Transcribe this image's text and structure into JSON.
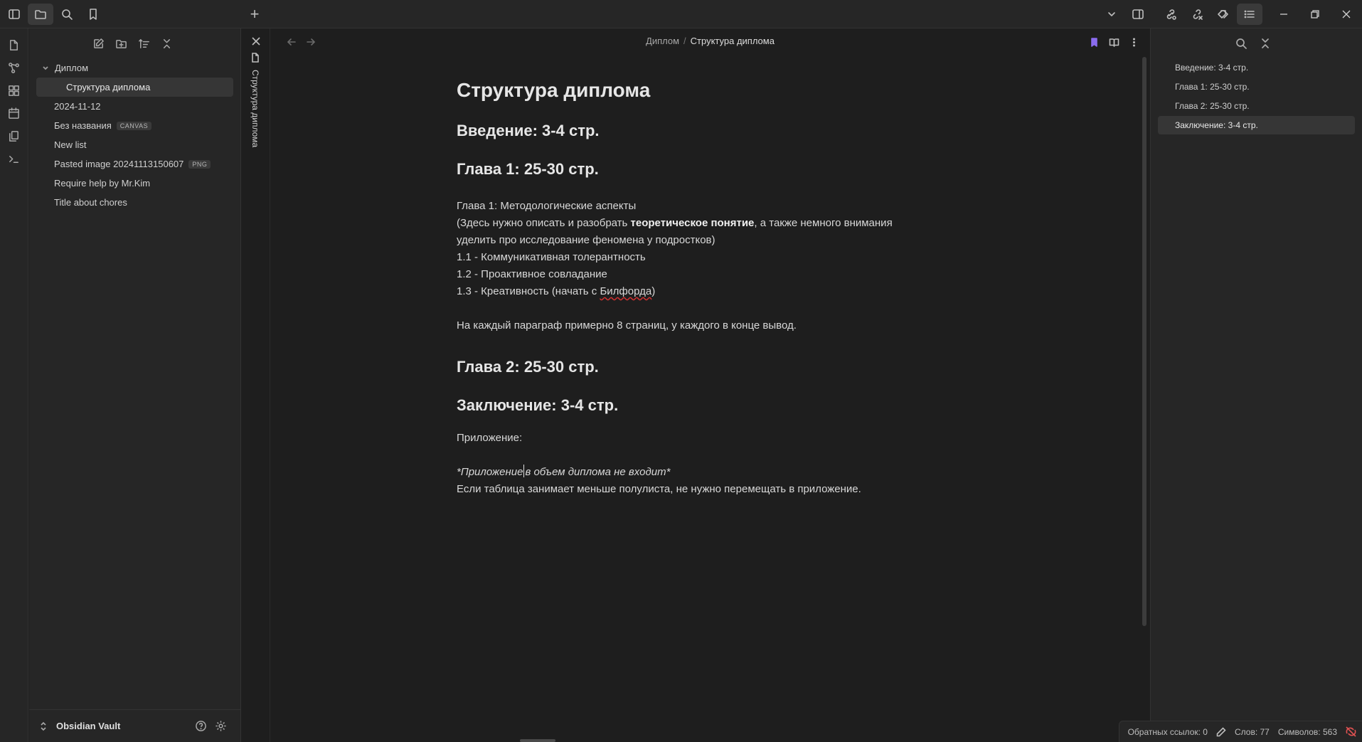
{
  "titlebar": {
    "new_tab_symbol": "+",
    "icons": [
      "sidebar-toggle-icon",
      "folder-icon",
      "search-icon",
      "bookmark-icon"
    ],
    "right_icons": [
      "chevron-down-icon",
      "split-pane-icon",
      "link-icon",
      "unlink-icon",
      "tags-icon",
      "outline-icon"
    ]
  },
  "ribbon": {
    "icons": [
      "files-icon",
      "graph-icon",
      "canvas-icon",
      "calendar-icon",
      "copy-icon",
      "terminal-icon"
    ]
  },
  "explorer": {
    "tools": [
      "new-note-icon",
      "new-folder-icon",
      "sort-icon",
      "collapse-icon"
    ],
    "folder": "Диплом",
    "child": "Структура диплома",
    "files": [
      {
        "name": "2024-11-12",
        "badge": ""
      },
      {
        "name": "Без названия",
        "badge": "CANVAS"
      },
      {
        "name": "New list",
        "badge": ""
      },
      {
        "name": "Pasted image 20241113150607",
        "badge": "PNG"
      },
      {
        "name": "Require help by Mr.Kim",
        "badge": ""
      },
      {
        "name": "Title about chores",
        "badge": ""
      }
    ],
    "vault_name": "Obsidian Vault"
  },
  "tab": {
    "title": "Структура диплома"
  },
  "breadcrumb": {
    "parent": "Диплом",
    "separator": "/",
    "current": "Структура диплома"
  },
  "document": {
    "title": "Структура диплома",
    "h_intro": "Введение: 3-4 стр.",
    "h_ch1": "Глава 1: 25-30 стр.",
    "ch1_title": "Глава 1: Методологические аспекты",
    "ch1_desc_before": "(Здесь нужно описать и разобрать ",
    "ch1_desc_bold": "теоретическое понятие",
    "ch1_desc_after": ", а также немного внимания уделить про исследование феномена у подростков)",
    "item_1": "1.1 - Коммуникативная толерантность",
    "item_2": "1.2 - Проактивное совладание",
    "item_3_before": "1.3 - Креативность (начать с ",
    "item_3_spell": "Билфорда",
    "item_3_after": ")",
    "paragraph_note": "На каждый параграф примерно 8 страниц, у каждого в конце вывод.",
    "h_ch2": "Глава 2: 25-30 стр.",
    "h_conclusion": "Заключение: 3-4 стр.",
    "appendix": "Приложение:",
    "italic_before": "*Приложение",
    "italic_after": "в объем диплома не входит*",
    "table_note": "Если таблица занимает меньше полулиста, не нужно перемещать в приложение."
  },
  "outline": {
    "items": [
      "Введение: 3-4 стр.",
      "Глава 1: 25-30 стр.",
      "Глава 2: 25-30 стр.",
      "Заключение: 3-4 стр."
    ],
    "active_index": 3
  },
  "status": {
    "backlinks": "Обратных ссылок: 0",
    "words": "Слов: 77",
    "chars": "Символов: 563"
  },
  "colors": {
    "bookmark_accent": "#8b6cef",
    "sync_error": "#e05252"
  }
}
